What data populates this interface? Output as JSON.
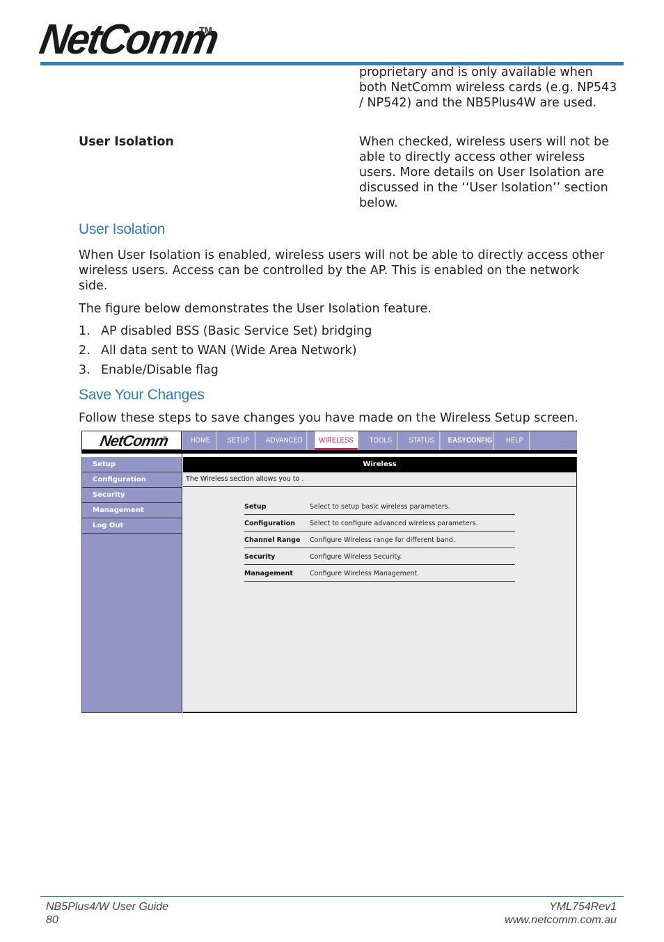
{
  "header": {
    "logo_text": "NetComm",
    "logo_tm": "TM"
  },
  "definitions": [
    {
      "term": "",
      "description": "proprietary and is only available when both NetComm wireless cards (e.g. NP543 / NP542) and the NB5Plus4W are used."
    },
    {
      "term": "User Isolation",
      "description": "When checked, wireless users will not be able to directly access other wireless users. More details on User Isolation are discussed in the ‘‘User Isolation’’ section below."
    }
  ],
  "sections": {
    "user_isolation": {
      "heading": "User Isolation",
      "paragraph1": "When User Isolation is enabled, wireless users will not be able to directly access other wireless users. Access can be controlled by the AP. This is enabled on the network side.",
      "paragraph2": "The figure below demonstrates the User Isolation feature.",
      "list": [
        {
          "num": "1.",
          "text": "AP disabled BSS (Basic Service Set) bridging"
        },
        {
          "num": "2.",
          "text": "All data sent to WAN (Wide Area Network)"
        },
        {
          "num": "3.",
          "text": "Enable/Disable flag"
        }
      ]
    },
    "save_changes": {
      "heading": "Save Your Changes",
      "paragraph": "Follow these steps to save changes you have made on the Wireless Setup screen."
    }
  },
  "router_ui": {
    "logo_text": "NetComm",
    "logo_reg": "®",
    "nav_tabs": [
      {
        "label": "HOME",
        "active": false
      },
      {
        "label": "SETUP",
        "active": false
      },
      {
        "label": "ADVANCED",
        "active": false
      },
      {
        "label": "WIRELESS",
        "active": true
      },
      {
        "label": "TOOLS",
        "active": false
      },
      {
        "label": "STATUS",
        "active": false
      },
      {
        "label": "EASYCONFIG",
        "active": false
      },
      {
        "label": "HELP",
        "active": false
      }
    ],
    "sidebar_items": [
      "Setup",
      "Configuration",
      "Security",
      "Management",
      "Log Out"
    ],
    "main_title": "Wireless",
    "main_description": "The Wireless section allows you to .",
    "rows": [
      {
        "label": "Setup",
        "description": "Select to setup basic wireless parameters."
      },
      {
        "label": "Configuration",
        "description": "Select to configure advanced wireless parameters."
      },
      {
        "label": "Channel Range",
        "description": "Configure Wireless range for different band."
      },
      {
        "label": "Security",
        "description": "Configure Wireless Security."
      },
      {
        "label": "Management",
        "description": "Configure Wireless Management."
      }
    ],
    "colors": {
      "nav_bg": "#9596c8",
      "active_tab": "#c3245a",
      "content_bg": "#ebebeb"
    }
  },
  "footer": {
    "guide_title": "NB5Plus4/W User Guide",
    "page_number": "80",
    "doc_code": "YML754Rev1",
    "website": "www.netcomm.com.au"
  },
  "colors": {
    "accent": "#2e7bc4"
  }
}
